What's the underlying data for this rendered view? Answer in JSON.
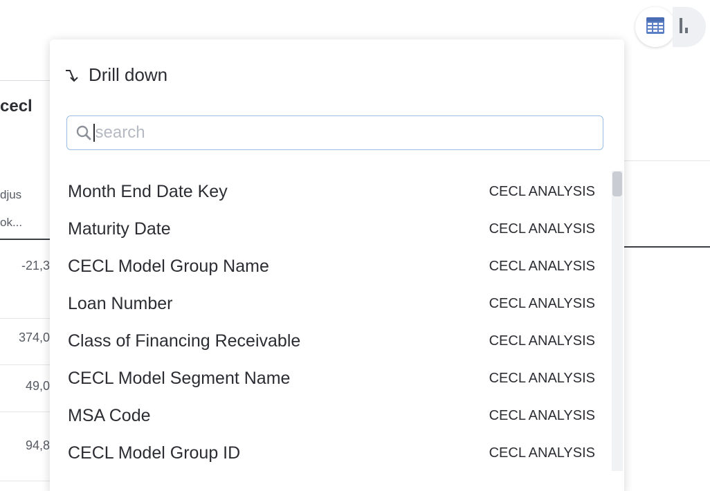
{
  "background": {
    "title": "cecl",
    "column_header_lines": [
      "djus",
      "ok..."
    ],
    "row_values": [
      "-21,3",
      "374,0",
      "49,0",
      "94,8"
    ]
  },
  "view_toggle": {
    "table_view_icon": "table-grid-icon",
    "other_view_icon": "chart-icon",
    "accent_color": "#5a7fc4"
  },
  "popover": {
    "title": "Drill down",
    "title_icon": "drill-down-arrow-icon",
    "search": {
      "placeholder": "search",
      "value": "",
      "icon": "search-icon"
    },
    "items": [
      {
        "name": "Month End Date Key",
        "source": "CECL ANALYSIS"
      },
      {
        "name": "Maturity Date",
        "source": "CECL ANALYSIS"
      },
      {
        "name": "CECL Model Group Name",
        "source": "CECL ANALYSIS"
      },
      {
        "name": "Loan Number",
        "source": "CECL ANALYSIS"
      },
      {
        "name": "Class of Financing Receivable",
        "source": "CECL ANALYSIS"
      },
      {
        "name": "CECL Model Segment Name",
        "source": "CECL ANALYSIS"
      },
      {
        "name": "MSA Code",
        "source": "CECL ANALYSIS"
      },
      {
        "name": "CECL Model Group ID",
        "source": "CECL ANALYSIS"
      }
    ]
  }
}
